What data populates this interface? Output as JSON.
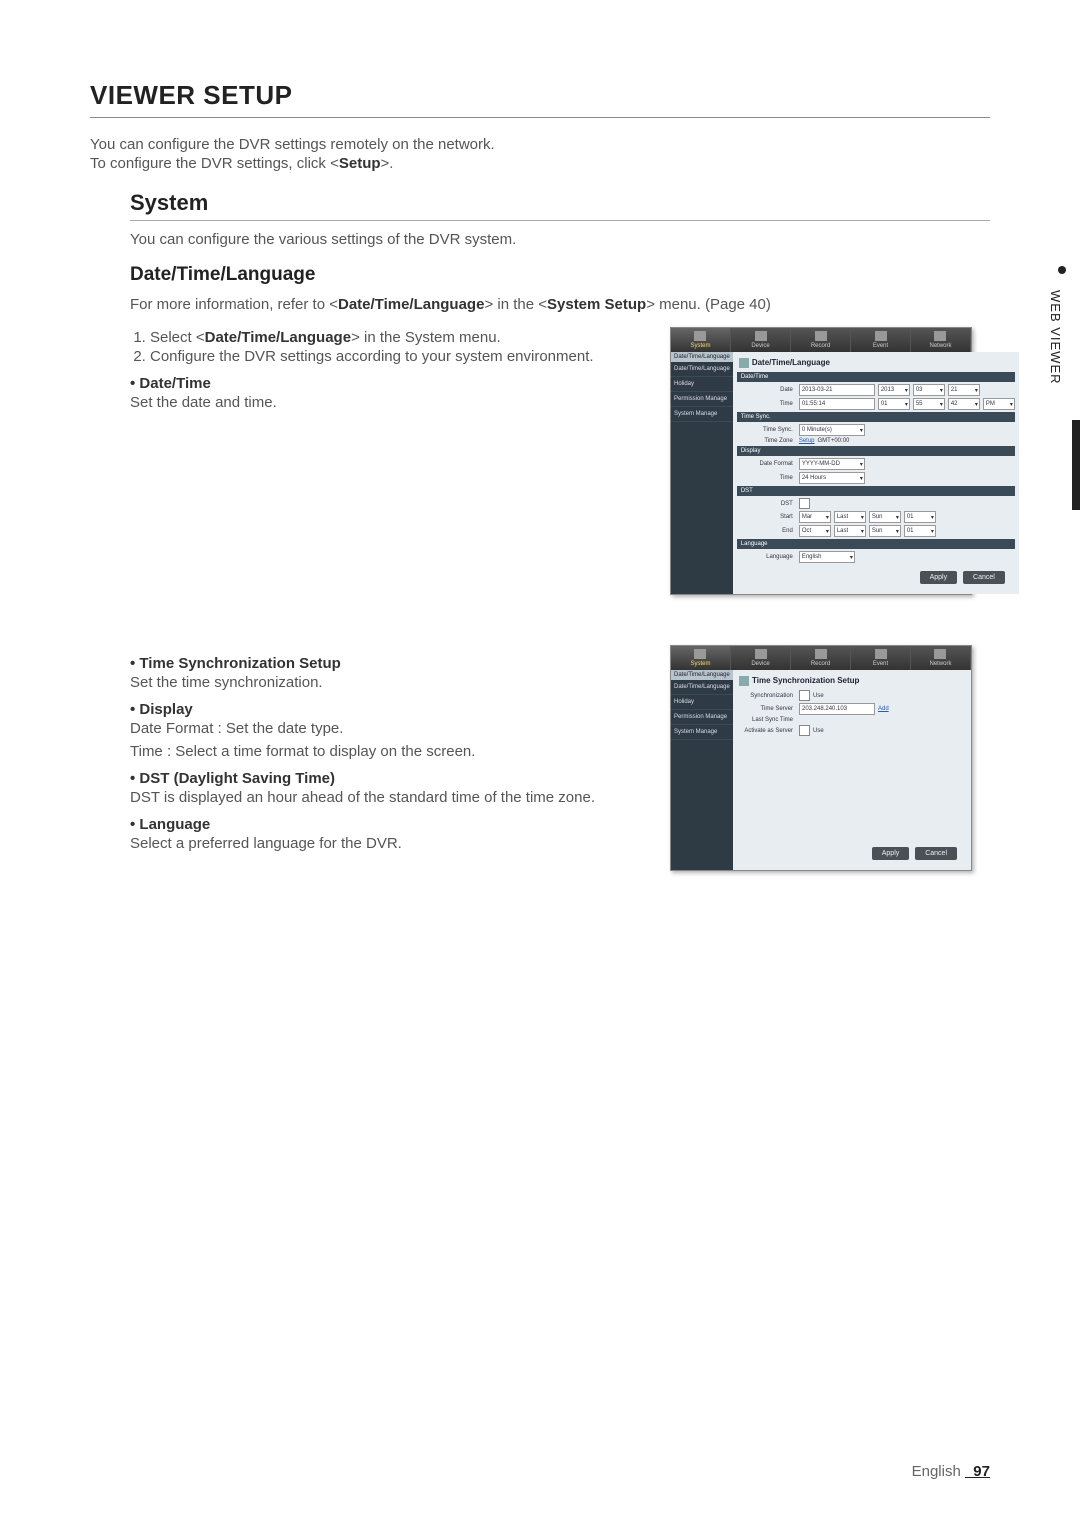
{
  "title": "VIEWER SETUP",
  "intro_line1_a": "You can configure the DVR settings remotely on the network.",
  "intro_line2_a": "To configure the DVR settings, click <",
  "intro_line2_b": "Setup",
  "intro_line2_c": ">.",
  "system_heading": "System",
  "system_desc": "You can configure the various settings of the DVR system.",
  "dtl_heading": "Date/Time/Language",
  "dtl_ref_a": "For more information, refer to <",
  "dtl_ref_b": "Date/Time/Language",
  "dtl_ref_c": "> in the <",
  "dtl_ref_d": "System Setup",
  "dtl_ref_e": "> menu. (Page 40)",
  "step1_a": "Select <",
  "step1_b": "Date/Time/Language",
  "step1_c": "> in the System menu.",
  "step2": "Configure the DVR settings according to your system environment.",
  "b1_head": "• Date/Time",
  "b1_desc": "Set the date and time.",
  "b2_head": "• Time Synchronization Setup",
  "b2_desc": "Set the time synchronization.",
  "b3_head": "• Display",
  "b3_desc1": "Date Format : Set the date type.",
  "b3_desc2": "Time : Select a time format to display on the screen.",
  "b4_head": "• DST (Daylight Saving Time)",
  "b4_desc": "DST is displayed an hour ahead of the standard time of the time zone.",
  "b5_head": "• Language",
  "b5_desc": "Select a preferred language for the DVR.",
  "sidetab": "WEB VIEWER",
  "footer_a": "English ",
  "footer_b": "_97",
  "shot_tabs": [
    "System",
    "Device",
    "Record",
    "Event",
    "Network"
  ],
  "shot_side_head": "Date/Time/Language",
  "shot_side_items": [
    "Date/Time/Language",
    "Holiday",
    "Permission Manage",
    "System Manage"
  ],
  "shot1": {
    "title": "Date/Time/Language",
    "sect_datetime": "Date/Time",
    "lbl_date": "Date",
    "lbl_time": "Time",
    "date_val": "2013-03-21",
    "date_year": "2013",
    "date_month": "03",
    "date_day": "21",
    "time_val": "01:55:14",
    "time_h": "01",
    "time_m": "55",
    "time_s": "42",
    "time_ampm": "PM",
    "sect_tsync": "Time Sync.",
    "lbl_tsync": "Time Sync.",
    "tsync_val": "0 Minute(s)",
    "lbl_tzone": "Time Zone",
    "tzone_btn": "Setup",
    "tzone_val": "GMT+00:00",
    "sect_display": "Display",
    "lbl_datefmt": "Date Format",
    "datefmt_val": "YYYY-MM-DD",
    "lbl_timefmt": "Time",
    "timefmt_val": "24 Hours",
    "sect_dst": "DST",
    "lbl_dst": "DST",
    "lbl_start": "Start",
    "start_mon": "Mar",
    "start_wk": "Last",
    "start_day": "Sun",
    "start_h": "01",
    "lbl_end": "End",
    "end_mon": "Oct",
    "end_wk": "Last",
    "end_day": "Sun",
    "end_h": "01",
    "sect_lang": "Language",
    "lbl_lang": "Language",
    "lang_val": "English",
    "btn_apply": "Apply",
    "btn_cancel": "Cancel"
  },
  "shot2": {
    "title": "Time Synchronization Setup",
    "lbl_sync": "Synchronization",
    "sync_use": "Use",
    "lbl_server": "Time Server",
    "server_val": "203.248.240.103",
    "server_add": "Add",
    "lbl_lastsync": "Last Sync Time",
    "lbl_actserver": "Activate as Server",
    "actserver_use": "Use",
    "btn_apply": "Apply",
    "btn_cancel": "Cancel"
  }
}
